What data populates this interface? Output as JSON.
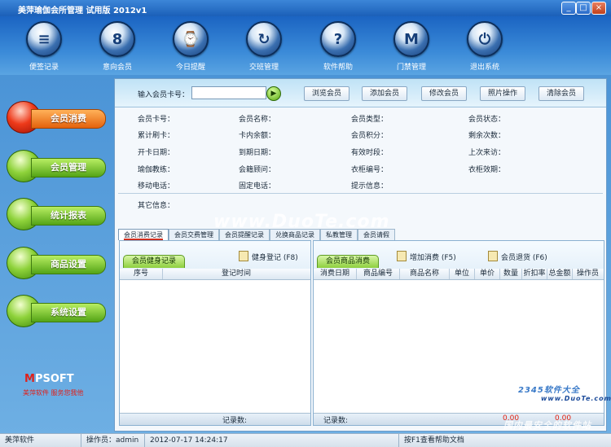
{
  "window": {
    "title": "美萍瑜伽会所管理  试用版  2012v1",
    "buttons": [
      "_",
      "□",
      "×"
    ]
  },
  "toolbar": [
    {
      "label": "便签记录",
      "glyph": "≡",
      "icon": "note-icon"
    },
    {
      "label": "意向会员",
      "glyph": "8",
      "icon": "member-icon"
    },
    {
      "label": "今日提醒",
      "glyph": "⌚",
      "icon": "clock-icon"
    },
    {
      "label": "交班管理",
      "glyph": "↻",
      "icon": "refresh-icon"
    },
    {
      "label": "软件帮助",
      "glyph": "?",
      "icon": "help-icon"
    },
    {
      "label": "门禁管理",
      "glyph": "M",
      "icon": "gate-icon"
    },
    {
      "label": "退出系统",
      "glyph": "⏻",
      "icon": "power-icon"
    }
  ],
  "nav": [
    {
      "label": "会员消费",
      "active": true
    },
    {
      "label": "会员管理",
      "active": false
    },
    {
      "label": "统计报表",
      "active": false
    },
    {
      "label": "商品设置",
      "active": false
    },
    {
      "label": "系统设置",
      "active": false
    }
  ],
  "brand": {
    "logo_m": "M",
    "logo_rest": "PSOFT",
    "slogan": "美萍软件  服务您我他"
  },
  "search": {
    "label": "输入会员卡号：",
    "value": "",
    "buttons": [
      "浏览会员",
      "添加会员",
      "修改会员",
      "照片操作",
      "清除会员"
    ]
  },
  "info_rows": [
    [
      "会员卡号：",
      "会员名称：",
      "会员类型：",
      "会员状态："
    ],
    [
      "累计刷卡：",
      "卡内余额：",
      "会员积分：",
      "剩余次数："
    ],
    [
      "开卡日期：",
      "到期日期：",
      "有效时段：",
      "上次来访："
    ],
    [
      "瑜伽教练：",
      "会籍顾问：",
      "衣柜编号：",
      "衣柜效期："
    ],
    [
      "移动电话：",
      "固定电话：",
      "提示信息：",
      ""
    ]
  ],
  "other_info_label": "其它信息：",
  "tabs": [
    "会员消费记录",
    "会员交费管理",
    "会员提醒记录",
    "兑换商品记录",
    "私教管理",
    "会员请假"
  ],
  "left_panel": {
    "tab": "会员健身记录",
    "button": "健身登记 (F8)",
    "columns": [
      "序号",
      "登记时间"
    ],
    "footer": "记录数:"
  },
  "right_panel": {
    "tab": "会员商品消费",
    "buttons": [
      "增加消费 (F5)",
      "会员退货 (F6)"
    ],
    "columns": [
      "消费日期",
      "商品编号",
      "商品名称",
      "单位",
      "单价",
      "数量",
      "折扣率",
      "总金额",
      "操作员"
    ],
    "footer": "记录数:",
    "totals": [
      "0.00",
      "0.00"
    ]
  },
  "status": {
    "company": "美萍软件",
    "operator": "操作员：admin",
    "datetime": "2012-07-17 14:24:17",
    "help": "按F1查看帮助文档"
  },
  "watermarks": [
    "www.DuoTe.com",
    "2345软件大全",
    "www.DuoTe.com",
    "国内最安全的软件站"
  ]
}
